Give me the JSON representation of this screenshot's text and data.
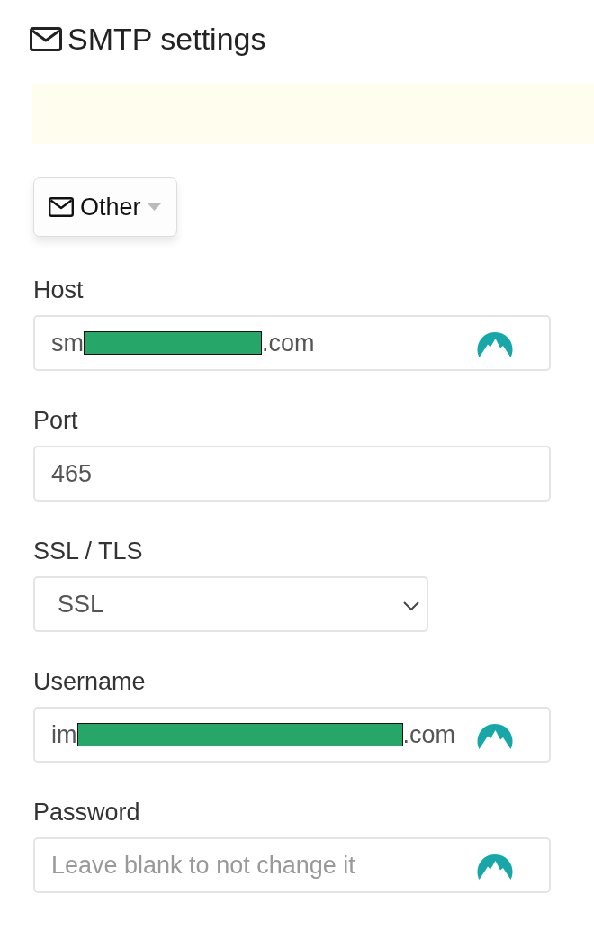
{
  "title": "SMTP settings",
  "provider_button": {
    "label": "Other"
  },
  "fields": [
    {
      "kind": "text",
      "label": "Host",
      "redacted": true,
      "value_before": "sm",
      "value_after": ".com",
      "autofill_icon": true
    },
    {
      "kind": "text",
      "label": "Port",
      "redacted": false,
      "value": "465",
      "autofill_icon": false
    },
    {
      "kind": "select",
      "label": "SSL / TLS",
      "value": "SSL"
    },
    {
      "kind": "text",
      "label": "Username",
      "redacted": true,
      "value_before": "im",
      "value_after": ".com",
      "autofill_icon": true
    },
    {
      "kind": "password",
      "label": "Password",
      "placeholder": "Leave blank to not change it",
      "autofill_icon": true
    }
  ]
}
